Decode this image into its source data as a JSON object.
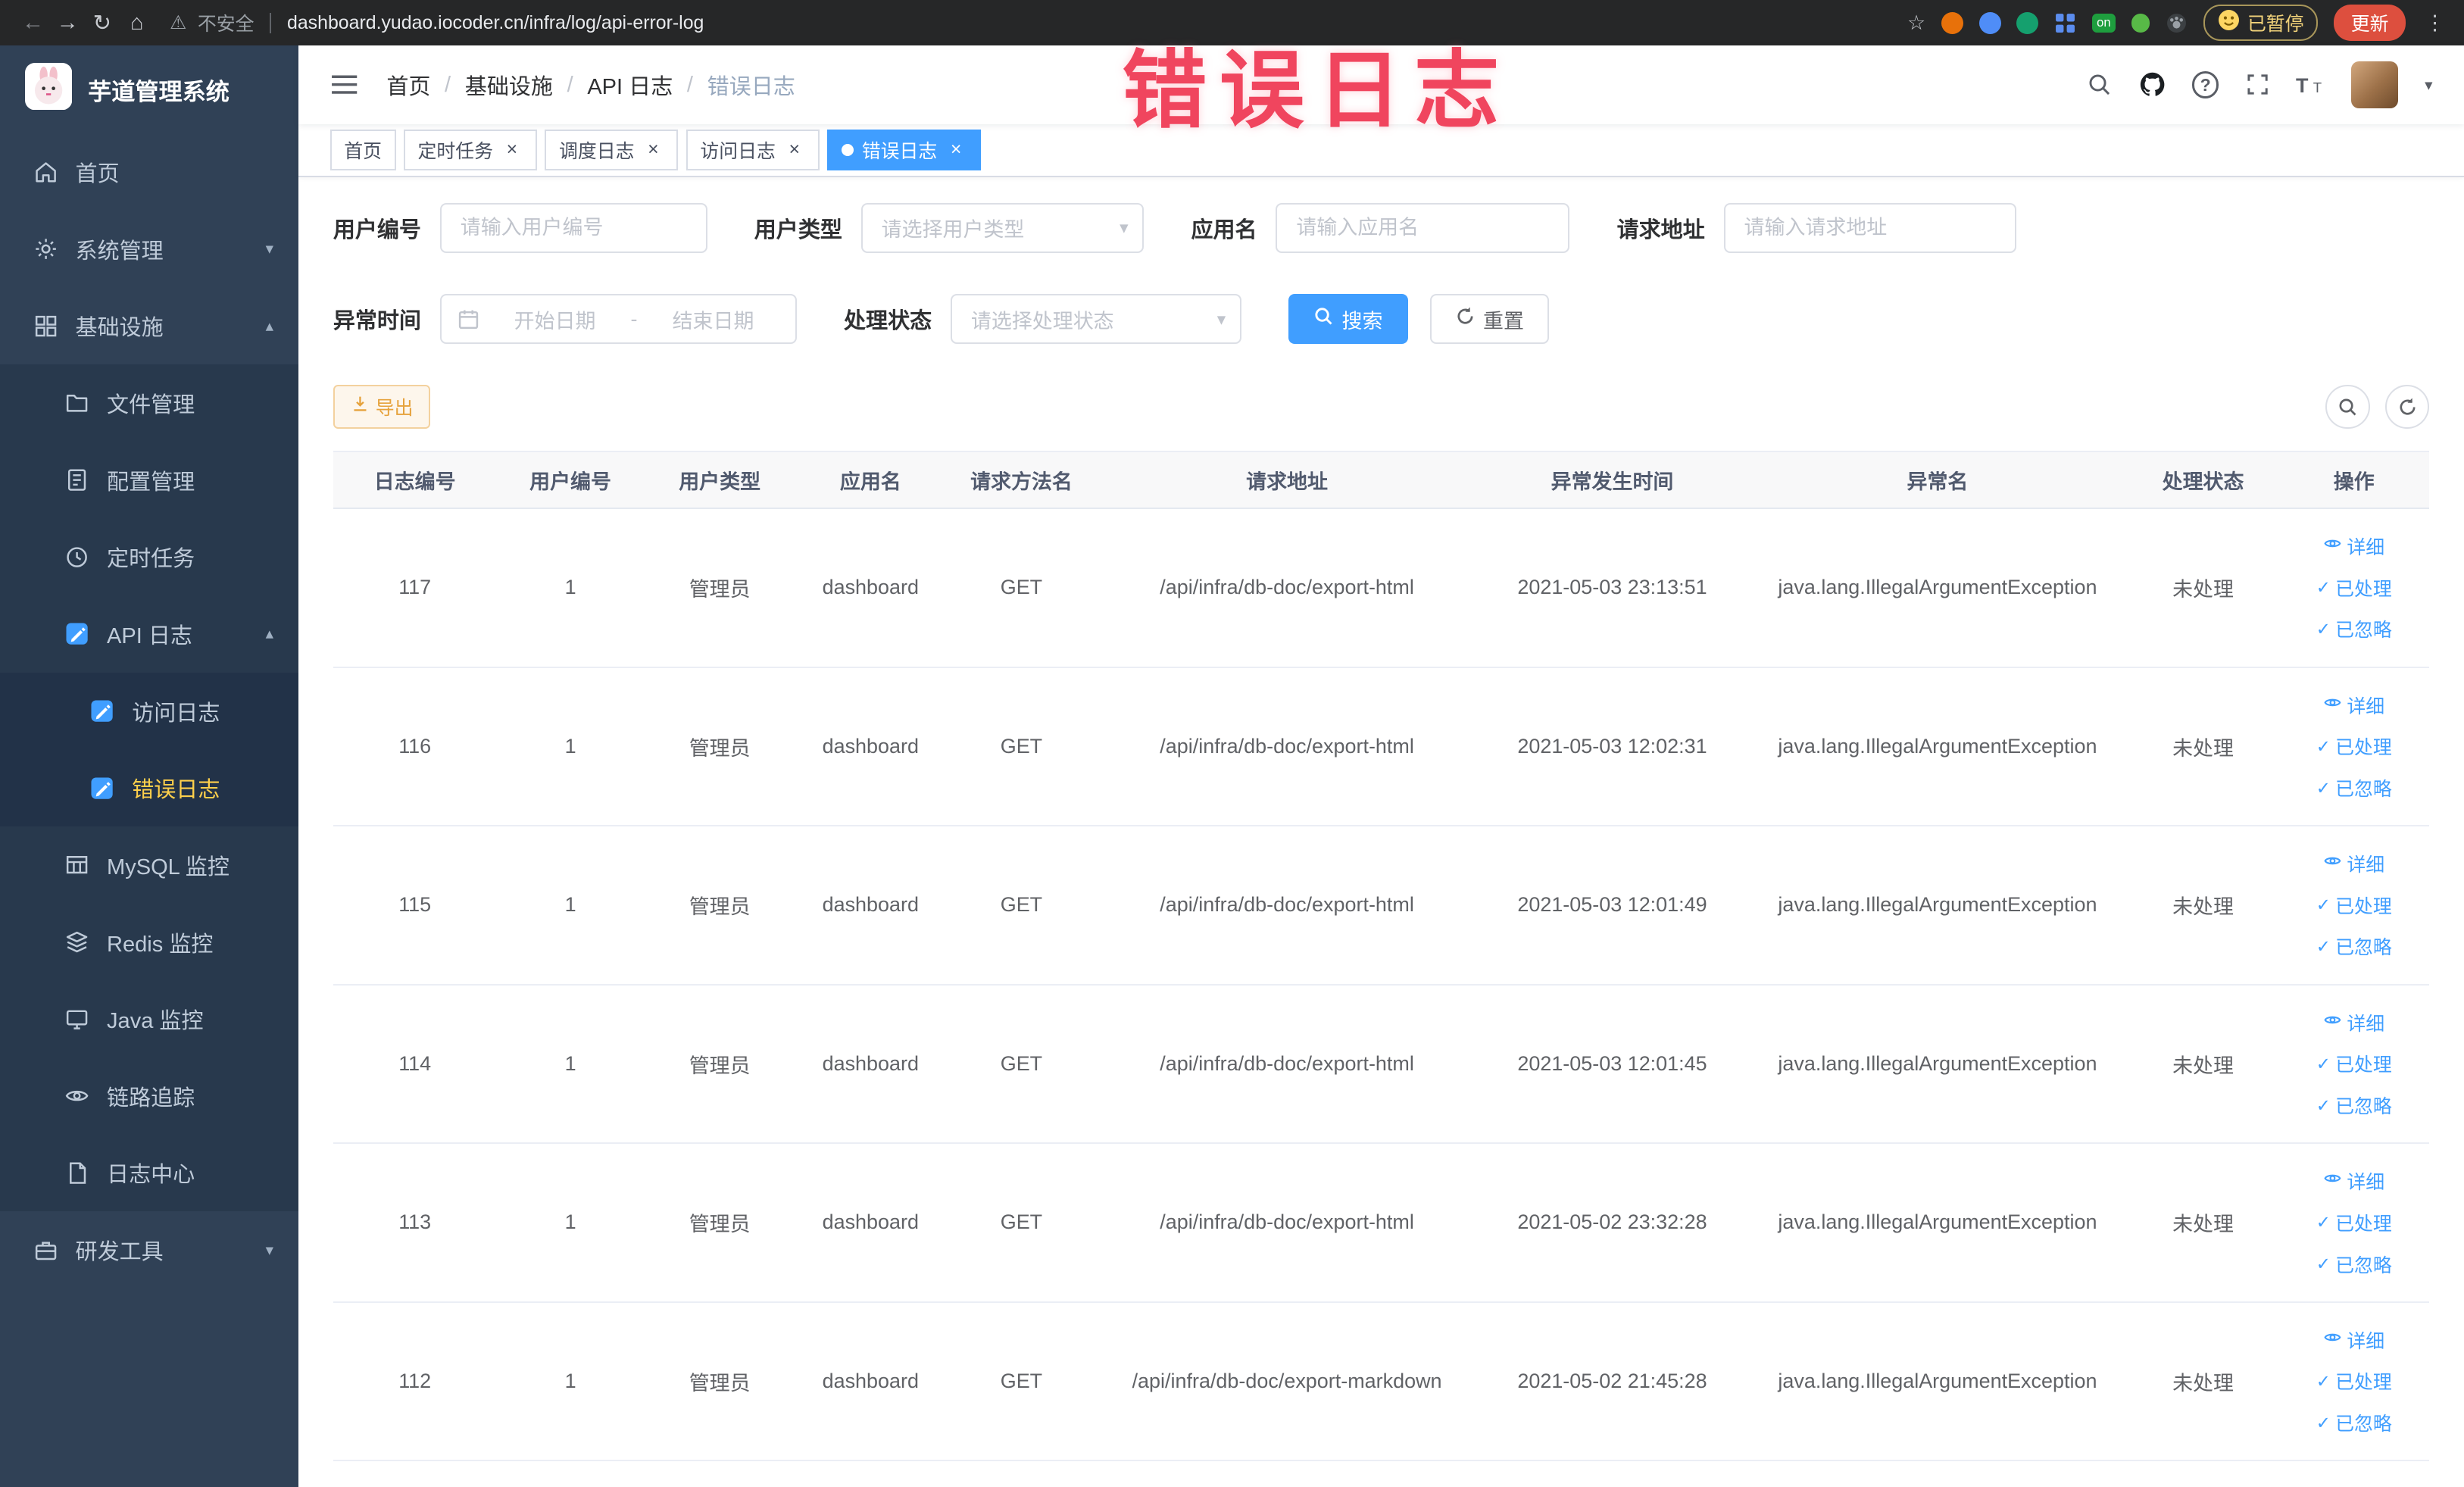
{
  "browser": {
    "security_label": "不安全",
    "url": "dashboard.yudao.iocoder.cn/infra/log/api-error-log",
    "extension_on_label": "on",
    "paused_badge": "已暂停",
    "update_label": "更新"
  },
  "annotation": {
    "text": "错误日志",
    "color": "#f0455e"
  },
  "sidebar": {
    "logo_title": "芋道管理系统",
    "items": [
      {
        "key": "home",
        "label": "首页",
        "icon": "home-icon",
        "level": 1
      },
      {
        "key": "system",
        "label": "系统管理",
        "icon": "gear-icon",
        "level": 1,
        "chevron": "down"
      },
      {
        "key": "infra",
        "label": "基础设施",
        "icon": "infra-icon",
        "level": 1,
        "chevron": "up"
      },
      {
        "key": "file",
        "label": "文件管理",
        "icon": "file-icon",
        "level": 2
      },
      {
        "key": "config",
        "label": "配置管理",
        "icon": "config-icon",
        "level": 2
      },
      {
        "key": "job",
        "label": "定时任务",
        "icon": "job-icon",
        "level": 2
      },
      {
        "key": "api-log",
        "label": "API 日志",
        "icon": "api-log-icon",
        "level": 2,
        "chevron": "up"
      },
      {
        "key": "access-log",
        "label": "访问日志",
        "icon": "access-log-icon",
        "level": 3
      },
      {
        "key": "error-log",
        "label": "错误日志",
        "icon": "error-log-icon",
        "level": 3,
        "active": true
      },
      {
        "key": "mysql",
        "label": "MySQL 监控",
        "icon": "mysql-icon",
        "level": 2
      },
      {
        "key": "redis",
        "label": "Redis 监控",
        "icon": "redis-icon",
        "level": 2
      },
      {
        "key": "java",
        "label": "Java 监控",
        "icon": "java-icon",
        "level": 2
      },
      {
        "key": "trace",
        "label": "链路追踪",
        "icon": "trace-icon",
        "level": 2
      },
      {
        "key": "log-center",
        "label": "日志中心",
        "icon": "log-center-icon",
        "level": 2
      },
      {
        "key": "dev-tools",
        "label": "研发工具",
        "icon": "tools-icon",
        "level": 1,
        "chevron": "down"
      }
    ]
  },
  "header": {
    "breadcrumb": [
      "首页",
      "基础设施",
      "API 日志",
      "错误日志"
    ]
  },
  "tabs": [
    {
      "key": "home",
      "label": "首页",
      "closable": false,
      "active": false
    },
    {
      "key": "cron-job",
      "label": "定时任务",
      "closable": true,
      "active": false
    },
    {
      "key": "job-log",
      "label": "调度日志",
      "closable": true,
      "active": false
    },
    {
      "key": "access-log",
      "label": "访问日志",
      "closable": true,
      "active": false
    },
    {
      "key": "error-log",
      "label": "错误日志",
      "closable": true,
      "active": true
    }
  ],
  "filters": {
    "user_id": {
      "label": "用户编号",
      "placeholder": "请输入用户编号"
    },
    "user_type": {
      "label": "用户类型",
      "placeholder": "请选择用户类型"
    },
    "app_name": {
      "label": "应用名",
      "placeholder": "请输入应用名"
    },
    "request_url": {
      "label": "请求地址",
      "placeholder": "请输入请求地址"
    },
    "exception_time": {
      "label": "异常时间",
      "start_placeholder": "开始日期",
      "separator": "-",
      "end_placeholder": "结束日期"
    },
    "process_status": {
      "label": "处理状态",
      "placeholder": "请选择处理状态"
    },
    "search_label": "搜索",
    "reset_label": "重置"
  },
  "toolbar": {
    "export_label": "导出"
  },
  "table": {
    "columns": [
      "日志编号",
      "用户编号",
      "用户类型",
      "应用名",
      "请求方法名",
      "请求地址",
      "异常发生时间",
      "异常名",
      "处理状态",
      "操作"
    ],
    "action_labels": [
      "详细",
      "已处理",
      "已忽略"
    ],
    "rows": [
      {
        "log_id": "117",
        "user_id": "1",
        "user_type": "管理员",
        "app_name": "dashboard",
        "method": "GET",
        "request_url": "/api/infra/db-doc/export-html",
        "time": "2021-05-03 23:13:51",
        "exception_name": "java.lang.IllegalArgumentException",
        "status": "未处理"
      },
      {
        "log_id": "116",
        "user_id": "1",
        "user_type": "管理员",
        "app_name": "dashboard",
        "method": "GET",
        "request_url": "/api/infra/db-doc/export-html",
        "time": "2021-05-03 12:02:31",
        "exception_name": "java.lang.IllegalArgumentException",
        "status": "未处理"
      },
      {
        "log_id": "115",
        "user_id": "1",
        "user_type": "管理员",
        "app_name": "dashboard",
        "method": "GET",
        "request_url": "/api/infra/db-doc/export-html",
        "time": "2021-05-03 12:01:49",
        "exception_name": "java.lang.IllegalArgumentException",
        "status": "未处理"
      },
      {
        "log_id": "114",
        "user_id": "1",
        "user_type": "管理员",
        "app_name": "dashboard",
        "method": "GET",
        "request_url": "/api/infra/db-doc/export-html",
        "time": "2021-05-03 12:01:45",
        "exception_name": "java.lang.IllegalArgumentException",
        "status": "未处理"
      },
      {
        "log_id": "113",
        "user_id": "1",
        "user_type": "管理员",
        "app_name": "dashboard",
        "method": "GET",
        "request_url": "/api/infra/db-doc/export-html",
        "time": "2021-05-02 23:32:28",
        "exception_name": "java.lang.IllegalArgumentException",
        "status": "未处理"
      },
      {
        "log_id": "112",
        "user_id": "1",
        "user_type": "管理员",
        "app_name": "dashboard",
        "method": "GET",
        "request_url": "/api/infra/db-doc/export-markdown",
        "time": "2021-05-02 21:45:28",
        "exception_name": "java.lang.IllegalArgumentException",
        "status": "未处理"
      }
    ]
  },
  "colors": {
    "primary": "#409EFF",
    "sidebar_bg": "#304156",
    "active_menu": "#ffd04b",
    "warning": "#e6a23c"
  }
}
